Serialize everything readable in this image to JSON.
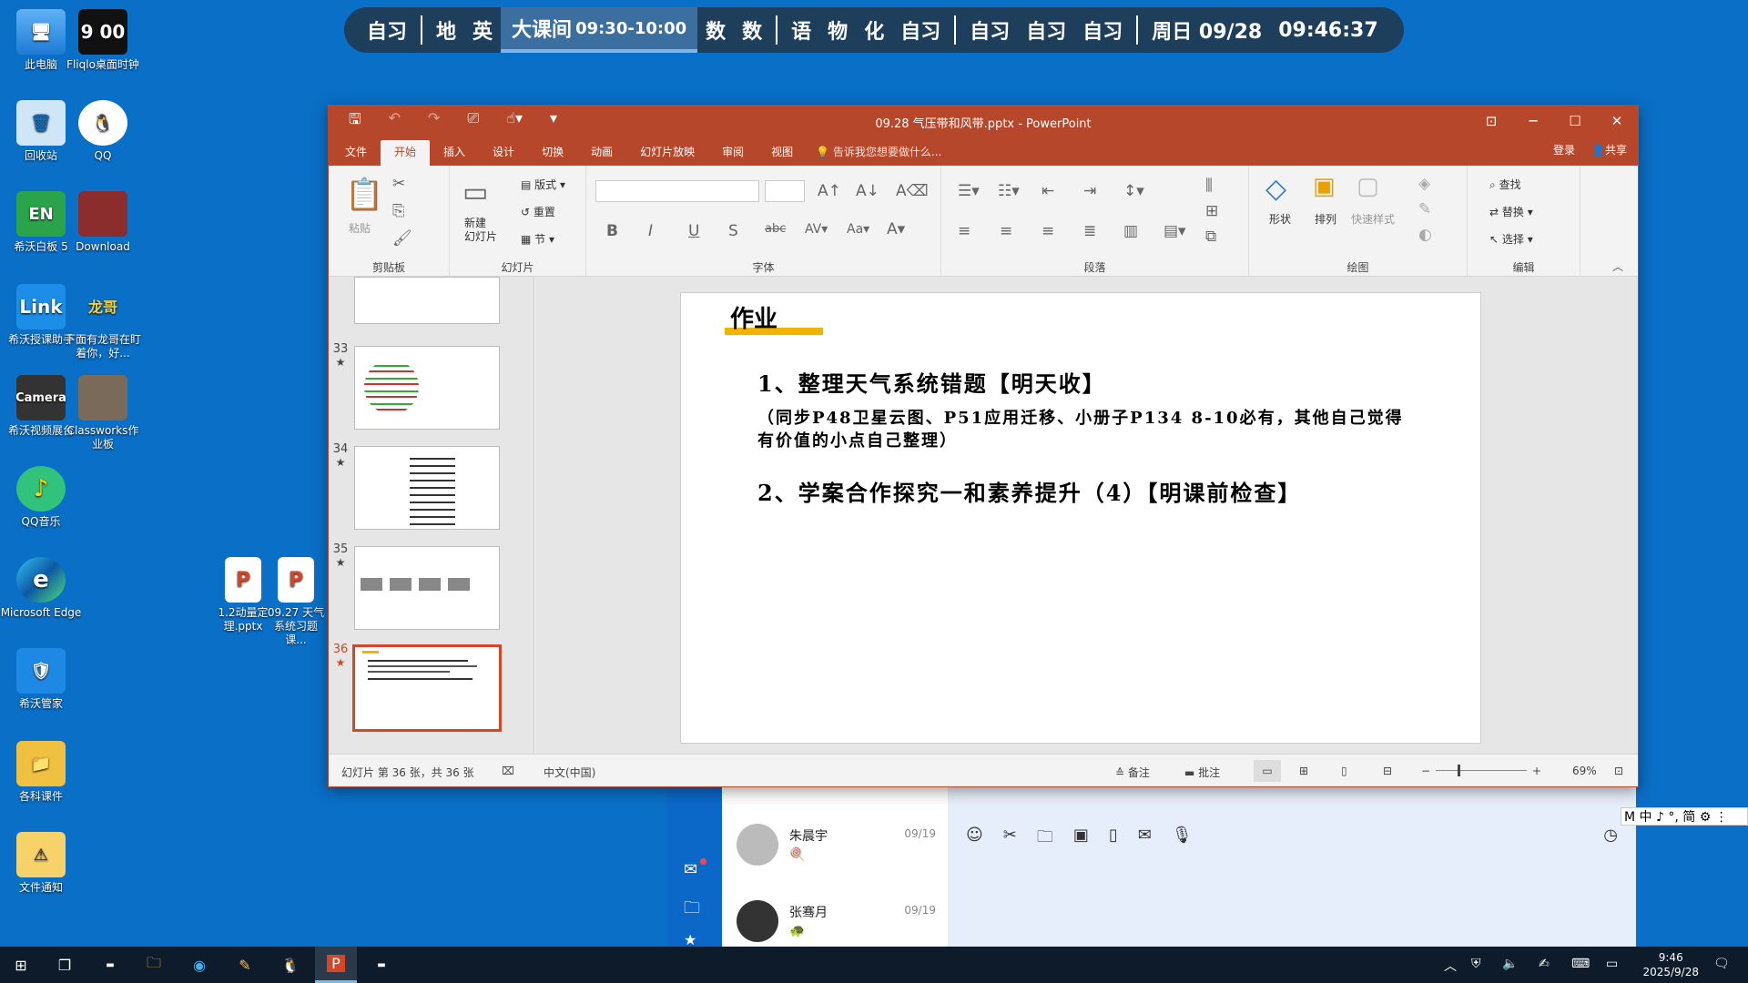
{
  "desktop": {
    "icons": [
      {
        "label": "此电脑",
        "glyph": "🖥",
        "icon": "computer-icon"
      },
      {
        "label": "Fliqlo桌面时钟",
        "glyph": "9 00",
        "icon": "clock-app-icon"
      },
      {
        "label": "回收站",
        "glyph": "🗑",
        "icon": "recycle-bin-icon"
      },
      {
        "label": "QQ",
        "glyph": "🐧",
        "icon": "qq-icon"
      },
      {
        "label": "希沃白板 5",
        "glyph": "EN",
        "icon": "whiteboard-icon"
      },
      {
        "label": "Download",
        "glyph": "",
        "icon": "download-folder-icon"
      },
      {
        "label": "希沃授课助手",
        "glyph": "Link",
        "icon": "link-icon"
      },
      {
        "label": "下面有龙哥在盯着你，好...",
        "glyph": "龙哥",
        "icon": "peek-icon"
      },
      {
        "label": "希沃视频展台",
        "glyph": "Camera",
        "icon": "camera-icon"
      },
      {
        "label": "Classworks作业板",
        "glyph": "",
        "icon": "classworks-icon"
      },
      {
        "label": "QQ音乐",
        "glyph": "♪",
        "icon": "qq-music-icon"
      },
      {
        "label": "Microsoft Edge",
        "glyph": "e",
        "icon": "edge-icon"
      },
      {
        "label": "希沃管家",
        "glyph": "🛡",
        "icon": "shield-icon"
      },
      {
        "label": "各科课件",
        "glyph": "📁",
        "icon": "folder-icon"
      },
      {
        "label": "文件通知",
        "glyph": "⚠",
        "icon": "file-notice-icon"
      },
      {
        "label": "1.2动量定理.pptx",
        "glyph": "P",
        "icon": "pptx-file-icon"
      },
      {
        "label": "09.27 天气系统习题课...",
        "glyph": "P",
        "icon": "pptx-file-icon"
      }
    ]
  },
  "schedule": {
    "items": [
      "自习",
      "|",
      "地",
      "英",
      "大课间",
      "数",
      "数",
      "|",
      "语",
      "物",
      "化",
      "自习",
      "|",
      "自习",
      "自习",
      "自习",
      "|"
    ],
    "current_label": "大课间",
    "current_time": "09:30-10:00",
    "date": "周日 09/28",
    "time": "09:46:37"
  },
  "ppt": {
    "title": "09.28 气压带和风带.pptx - PowerPoint",
    "tabs": [
      "文件",
      "开始",
      "插入",
      "设计",
      "切换",
      "动画",
      "幻灯片放映",
      "审阅",
      "视图"
    ],
    "active_tab": "开始",
    "tell_me": "告诉我您想要做什么...",
    "login": "登录",
    "share": "共享",
    "ribbon": {
      "clipboard": {
        "paste": "粘贴",
        "group": "剪贴板"
      },
      "slides": {
        "new_slide": "新建\n幻灯片",
        "layout": "版式",
        "reset": "重置",
        "section": "节",
        "group": "幻灯片"
      },
      "font": {
        "group": "字体"
      },
      "paragraph": {
        "group": "段落"
      },
      "drawing": {
        "shape": "形状",
        "arrange": "排列",
        "quick_styles": "快速样式",
        "group": "绘图"
      },
      "editing": {
        "find": "查找",
        "replace": "替换",
        "select": "选择",
        "group": "编辑"
      }
    },
    "thumbnails": [
      {
        "num": "",
        "star": "",
        "selected": false
      },
      {
        "num": "33",
        "star": "★",
        "selected": false
      },
      {
        "num": "34",
        "star": "★",
        "selected": false
      },
      {
        "num": "35",
        "star": "★",
        "selected": false
      },
      {
        "num": "36",
        "star": "★",
        "selected": true
      }
    ],
    "slide": {
      "title": "作业",
      "line1": "1、整理天气系统错题【明天收】",
      "line2": "（同步P48卫星云图、P51应用迁移、小册子P134 8-10必有，其他自己觉得有价值的小点自己整理）",
      "line3": "2、学案合作探究一和素养提升（4）【明课前检查】"
    },
    "status": {
      "slide_info": "幻灯片 第 36 张，共 36 张",
      "language": "中文(中国)",
      "notes": "备注",
      "comments": "批注",
      "zoom": "69%"
    }
  },
  "chat": {
    "contacts": [
      {
        "name": "朱晨宇",
        "date": "09/19",
        "emoji": "🍭"
      },
      {
        "name": "张骞月",
        "date": "09/19",
        "emoji": "🐢"
      }
    ]
  },
  "ime": {
    "text": "M 中 ♪ °, 简 ⚙ ⋮"
  },
  "taskbar": {
    "time": "9:46",
    "date": "2025/9/28"
  }
}
